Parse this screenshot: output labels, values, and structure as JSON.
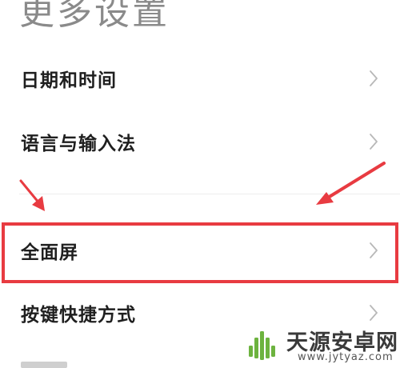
{
  "page": {
    "title": "更多设置"
  },
  "settings": {
    "items": [
      {
        "label": "日期和时间",
        "icon": "chevron-right-icon"
      },
      {
        "label": "语言与输入法",
        "icon": "chevron-right-icon"
      },
      {
        "label": "全面屏",
        "icon": "chevron-right-icon",
        "highlighted": true
      },
      {
        "label": "按键快捷方式",
        "icon": "chevron-right-icon"
      }
    ]
  },
  "annotation": {
    "highlight_color": "#e83b41",
    "arrow_color": "#e83b41"
  },
  "watermark": {
    "name": "天源安卓网",
    "url": "www.jytyaz.com",
    "logo_color": "#6db33f"
  }
}
